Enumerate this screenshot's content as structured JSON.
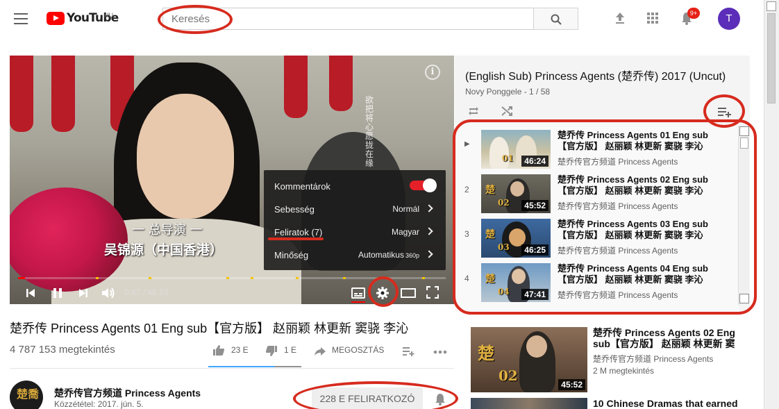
{
  "header": {
    "logo_text": "YouTube",
    "region": "HU",
    "search_placeholder": "Keresés",
    "notification_count": "9+",
    "avatar_letter": "T"
  },
  "player": {
    "burned_sub_line1": "一 总导演 一",
    "burned_sub_line2": "吴锦源（中国香港）",
    "vertical_text": "欲把将心愿拢在缘",
    "time": "0:47 / 46:23",
    "progress_percent": 1.7,
    "settings": {
      "annotations_label": "Kommentárok",
      "annotations_on": true,
      "speed_label": "Sebesség",
      "speed_value": "Normál",
      "subtitles_label": "Feliratok (7)",
      "subtitles_value": "Magyar",
      "quality_label": "Minőség",
      "quality_value": "Automatikus",
      "quality_sup": "360p"
    }
  },
  "video": {
    "title": "楚乔传 Princess Agents 01 Eng sub【官方版】 赵丽颖 林更新 窦骁 李沁",
    "views": "4 787 153 megtekintés",
    "likes": "23 E",
    "dislikes": "1 E",
    "share_label": "MEGOSZTÁS",
    "channel_name": "楚乔传官方频道 Princess Agents",
    "published": "Közzététel: 2017. jún. 5.",
    "subscribe_label": "228 E FELIRATKOZÓ"
  },
  "playlist": {
    "title": "(English Sub) Princess Agents (楚乔传) 2017 (Uncut)",
    "owner_progress": "Novy Ponggele - 1 / 58",
    "items": [
      {
        "index": "▶",
        "title": "楚乔传 Princess Agents 01 Eng sub【官方版】 赵丽颖 林更新 窦骁 李沁",
        "channel": "楚乔传官方频道 Princess Agents",
        "duration": "46:24"
      },
      {
        "index": "2",
        "title": "楚乔传 Princess Agents 02 Eng sub【官方版】 赵丽颖 林更新 窦骁 李沁",
        "channel": "楚乔传官方频道 Princess Agents",
        "duration": "45:52"
      },
      {
        "index": "3",
        "title": "楚乔传 Princess Agents 03 Eng sub【官方版】 赵丽颖 林更新 窦骁 李沁",
        "channel": "楚乔传官方频道 Princess Agents",
        "duration": "46:25"
      },
      {
        "index": "4",
        "title": "楚乔传 Princess Agents 04 Eng sub【官方版】 赵丽颖 林更新 窦骁 李沁",
        "channel": "楚乔传官方频道 Princess Agents",
        "duration": "47:41"
      }
    ]
  },
  "related": [
    {
      "title": "楚乔传 Princess Agents 02 Eng sub【官方版】 赵丽颖 林更新 窦",
      "channel": "楚乔传官方频道 Princess Agents",
      "views": "2 M megtekintés",
      "duration": "45:52"
    },
    {
      "title": "10 Chinese Dramas that earned",
      "channel": "",
      "views": "",
      "duration": ""
    }
  ],
  "colors": {
    "brand_red": "#ff0000",
    "annotation_red": "#d62b1e",
    "like_blue": "#3ea6ff",
    "avatar_purple": "#5b2db8",
    "playlist_bg": "#f4f4f4"
  },
  "icons": [
    "hamburger-icon",
    "search-icon",
    "upload-icon",
    "apps-icon",
    "bell-icon",
    "info-icon",
    "previous-icon",
    "pause-icon",
    "next-icon",
    "volume-icon",
    "subtitles-icon",
    "settings-gear-icon",
    "theater-icon",
    "fullscreen-icon",
    "thumb-up-icon",
    "thumb-down-icon",
    "share-icon",
    "add-to-playlist-icon",
    "more-icon",
    "loop-icon",
    "shuffle-icon",
    "save-playlist-icon"
  ]
}
